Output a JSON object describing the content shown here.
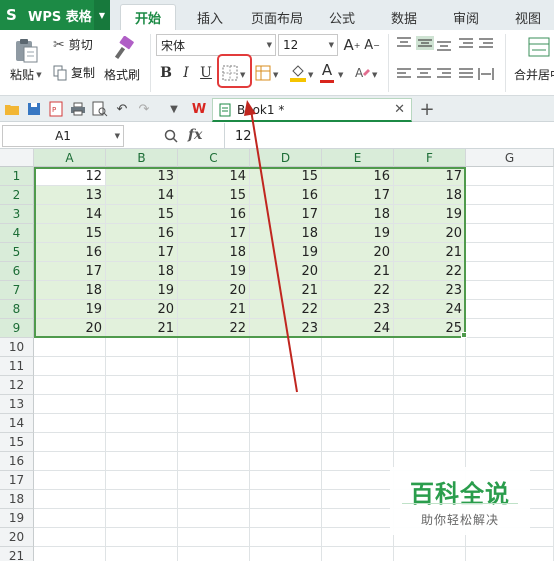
{
  "app": {
    "name": "WPS 表格",
    "logo_glyph": "S"
  },
  "tabs": [
    {
      "label": "开始",
      "active": true
    },
    {
      "label": "插入",
      "active": false
    },
    {
      "label": "页面布局",
      "active": false
    },
    {
      "label": "公式",
      "active": false
    },
    {
      "label": "数据",
      "active": false
    },
    {
      "label": "审阅",
      "active": false
    },
    {
      "label": "视图",
      "active": false
    }
  ],
  "ribbon": {
    "paste_label": "粘贴",
    "cut_label": "剪切",
    "copy_label": "复制",
    "format_painter_label": "格式刷",
    "font_name": "宋体",
    "font_size": "12",
    "bold_glyph": "B",
    "italic_glyph": "I",
    "underline_glyph": "U",
    "merge_label": "合并居中",
    "highlight_color": "#f5c400",
    "font_color": "#d9251c"
  },
  "quick_access": {
    "doc_tab_label": "Book1 *",
    "new_tab_glyph": "+"
  },
  "formula_bar": {
    "cell_ref": "A1",
    "fx_label": "fx",
    "value": "12"
  },
  "sheet": {
    "columns": [
      "A",
      "B",
      "C",
      "D",
      "E",
      "F",
      "G"
    ],
    "rows": [
      "1",
      "2",
      "3",
      "4",
      "5",
      "6",
      "7",
      "8",
      "9",
      "10",
      "11",
      "12",
      "13",
      "14",
      "15",
      "16",
      "17",
      "18",
      "19",
      "20",
      "21"
    ],
    "data": [
      [
        12,
        13,
        14,
        15,
        16,
        17
      ],
      [
        13,
        14,
        15,
        16,
        17,
        18
      ],
      [
        14,
        15,
        16,
        17,
        18,
        19
      ],
      [
        15,
        16,
        17,
        18,
        19,
        20
      ],
      [
        16,
        17,
        18,
        19,
        20,
        21
      ],
      [
        17,
        18,
        19,
        20,
        21,
        22
      ],
      [
        18,
        19,
        20,
        21,
        22,
        23
      ],
      [
        19,
        20,
        21,
        22,
        23,
        24
      ],
      [
        20,
        21,
        22,
        23,
        24,
        25
      ]
    ],
    "selection_color": "#4f9a4c"
  },
  "watermark": {
    "title": "百科全说",
    "subtitle": "助你轻松解决"
  },
  "annotation_color": "#c0261f"
}
